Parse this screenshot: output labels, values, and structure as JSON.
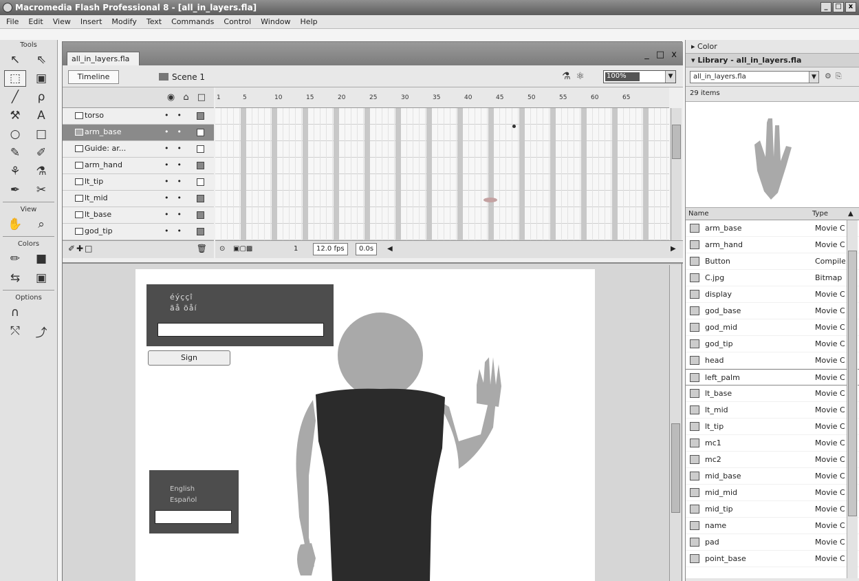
{
  "window": {
    "title": "Macromedia Flash Professional 8 - [all_in_layers.fla]",
    "controls": [
      "_",
      "□",
      "x"
    ]
  },
  "menu": [
    "File",
    "Edit",
    "View",
    "Insert",
    "Modify",
    "Text",
    "Commands",
    "Control",
    "Window",
    "Help"
  ],
  "tools": {
    "title": "Tools",
    "view_label": "View",
    "colors_label": "Colors",
    "options_label": "Options",
    "items": [
      {
        "name": "selection-tool",
        "glyph": "↖"
      },
      {
        "name": "subselection-tool",
        "glyph": "⇖"
      },
      {
        "name": "free-transform-tool",
        "glyph": "⬚"
      },
      {
        "name": "gradient-transform-tool",
        "glyph": "▣"
      },
      {
        "name": "line-tool",
        "glyph": "╱"
      },
      {
        "name": "lasso-tool",
        "glyph": "ρ"
      },
      {
        "name": "pen-tool",
        "glyph": "⚒"
      },
      {
        "name": "text-tool",
        "glyph": "A"
      },
      {
        "name": "oval-tool",
        "glyph": "○"
      },
      {
        "name": "rectangle-tool",
        "glyph": "□"
      },
      {
        "name": "pencil-tool",
        "glyph": "✎"
      },
      {
        "name": "brush-tool",
        "glyph": "✐"
      },
      {
        "name": "ink-bottle-tool",
        "glyph": "⚘"
      },
      {
        "name": "paint-bucket-tool",
        "glyph": "⚗"
      },
      {
        "name": "eyedropper-tool",
        "glyph": "✒"
      },
      {
        "name": "eraser-tool",
        "glyph": "✂"
      }
    ],
    "view_items": [
      {
        "name": "hand-tool",
        "glyph": "✋"
      },
      {
        "name": "zoom-tool",
        "glyph": "⌕"
      }
    ],
    "color_items": [
      {
        "name": "stroke-color",
        "glyph": "✏"
      },
      {
        "name": "fill-color",
        "glyph": "■"
      }
    ]
  },
  "document": {
    "tab": "all_in_layers.fla",
    "window_controls": "_ □ x",
    "timeline_button": "Timeline",
    "scene": "Scene 1",
    "zoom": "100%"
  },
  "timeline": {
    "header_icons": "◉ ⌂ □",
    "layers": [
      {
        "name": "torso",
        "selected": false,
        "box_open": false
      },
      {
        "name": "arm_base",
        "selected": true,
        "box_open": true
      },
      {
        "name": "Guide: ar...",
        "selected": false,
        "box_open": true
      },
      {
        "name": "arm_hand",
        "selected": false,
        "box_open": false
      },
      {
        "name": "lt_tip",
        "selected": false,
        "box_open": true
      },
      {
        "name": "lt_mid",
        "selected": false,
        "box_open": false
      },
      {
        "name": "lt_base",
        "selected": false,
        "box_open": false
      },
      {
        "name": "god_tip",
        "selected": false,
        "box_open": false
      }
    ],
    "ruler": [
      "1",
      "5",
      "10",
      "15",
      "20",
      "25",
      "30",
      "35",
      "40",
      "45",
      "50",
      "55",
      "60",
      "65"
    ],
    "status": {
      "frame": "1",
      "fps": "12.0 fps",
      "time": "0.0s"
    }
  },
  "stage": {
    "panel_top": {
      "line1": "éýççî",
      "line2": "ãå öåí"
    },
    "sign_button": "Sign",
    "panel_bottom": {
      "line1": "English",
      "line2": "Español"
    }
  },
  "right": {
    "color_panel": "▸ Color",
    "library_panel": "▾ Library - all_in_layers.fla",
    "library_select": "all_in_layers.fla",
    "item_count": "29 items",
    "col_name": "Name",
    "col_type": "Type",
    "items": [
      {
        "name": "arm_base",
        "type": "Movie Clip"
      },
      {
        "name": "arm_hand",
        "type": "Movie Clip"
      },
      {
        "name": "Button",
        "type": "Compiled Clip"
      },
      {
        "name": "C.jpg",
        "type": "Bitmap"
      },
      {
        "name": "display",
        "type": "Movie Clip"
      },
      {
        "name": "god_base",
        "type": "Movie Clip"
      },
      {
        "name": "god_mid",
        "type": "Movie Clip"
      },
      {
        "name": "god_tip",
        "type": "Movie Clip"
      },
      {
        "name": "head",
        "type": "Movie Clip"
      },
      {
        "name": "left_palm",
        "type": "Movie Clip"
      },
      {
        "name": "lt_base",
        "type": "Movie Clip"
      },
      {
        "name": "lt_mid",
        "type": "Movie Clip"
      },
      {
        "name": "lt_tip",
        "type": "Movie Clip"
      },
      {
        "name": "mc1",
        "type": "Movie Clip"
      },
      {
        "name": "mc2",
        "type": "Movie Clip"
      },
      {
        "name": "mid_base",
        "type": "Movie Clip"
      },
      {
        "name": "mid_mid",
        "type": "Movie Clip"
      },
      {
        "name": "mid_tip",
        "type": "Movie Clip"
      },
      {
        "name": "name",
        "type": "Movie Clip"
      },
      {
        "name": "pad",
        "type": "Movie Clip"
      },
      {
        "name": "point_base",
        "type": "Movie Clip"
      }
    ],
    "selected_item": "left_palm"
  },
  "colors": {
    "accent": "#8a8a8a",
    "torso": "#2b2b2b",
    "skin": "#a9a9a9"
  }
}
